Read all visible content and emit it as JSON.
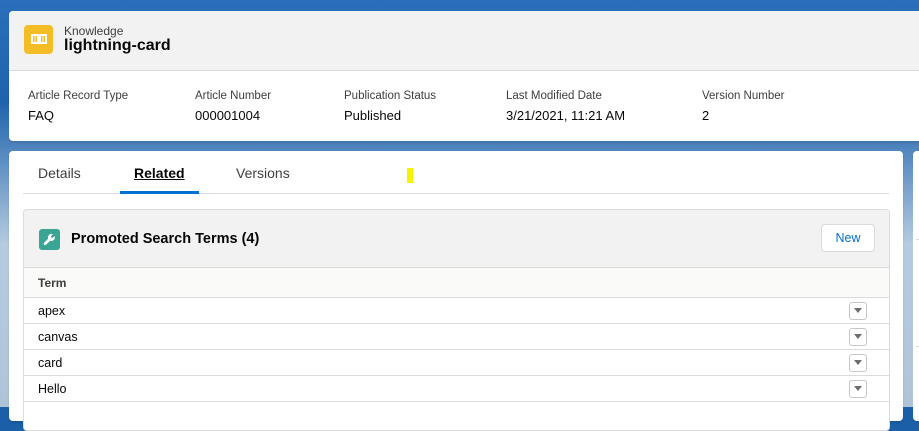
{
  "header": {
    "object_type": "Knowledge",
    "record_title": "lightning-card",
    "object_icon": "knowledge-book-icon",
    "fields": [
      {
        "label": "Article Record Type",
        "value": "FAQ"
      },
      {
        "label": "Article Number",
        "value": "000001004"
      },
      {
        "label": "Publication Status",
        "value": "Published"
      },
      {
        "label": "Last Modified Date",
        "value": "3/21/2021, 11:21 AM"
      },
      {
        "label": "Version Number",
        "value": "2"
      }
    ]
  },
  "tabs": [
    {
      "label": "Details",
      "active": false
    },
    {
      "label": "Related",
      "active": true
    },
    {
      "label": "Versions",
      "active": false
    }
  ],
  "related_list": {
    "icon": "wrench-icon",
    "icon_color": "#3ba594",
    "title": "Promoted Search Terms (4)",
    "new_button_label": "New",
    "column_header": "Term",
    "rows": [
      {
        "term": "apex"
      },
      {
        "term": "canvas"
      },
      {
        "term": "card"
      },
      {
        "term": "Hello"
      }
    ]
  },
  "colors": {
    "brand": "#0070d2",
    "object_icon_bg": "#f4bc25",
    "highlight_mark": "#f5f500"
  }
}
